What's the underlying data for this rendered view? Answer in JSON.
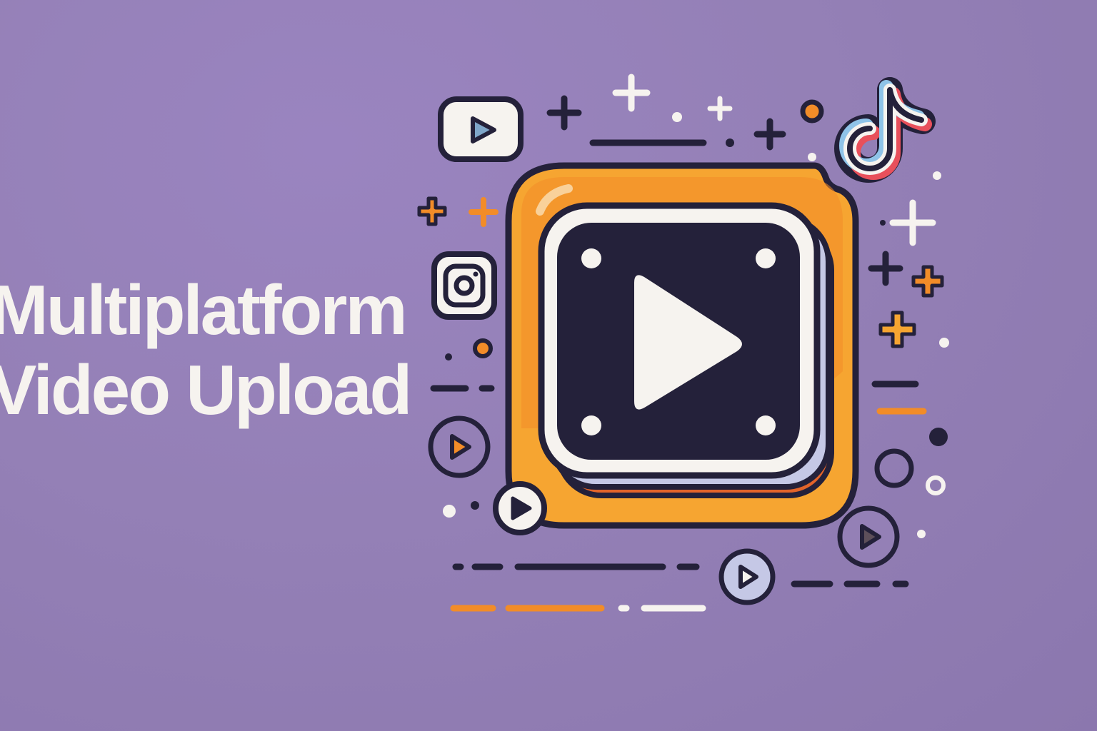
{
  "headline": {
    "line1": "Multiplatform",
    "line2": "Video Upload"
  },
  "icons": {
    "main": "play-icon",
    "platforms": [
      "youtube-icon",
      "tiktok-icon",
      "instagram-icon"
    ]
  },
  "colors": {
    "background": "#9480b6",
    "accent_orange": "#f28c28",
    "dark": "#24213a",
    "light": "#f6f3ef",
    "lavender": "#c5c8e6"
  }
}
